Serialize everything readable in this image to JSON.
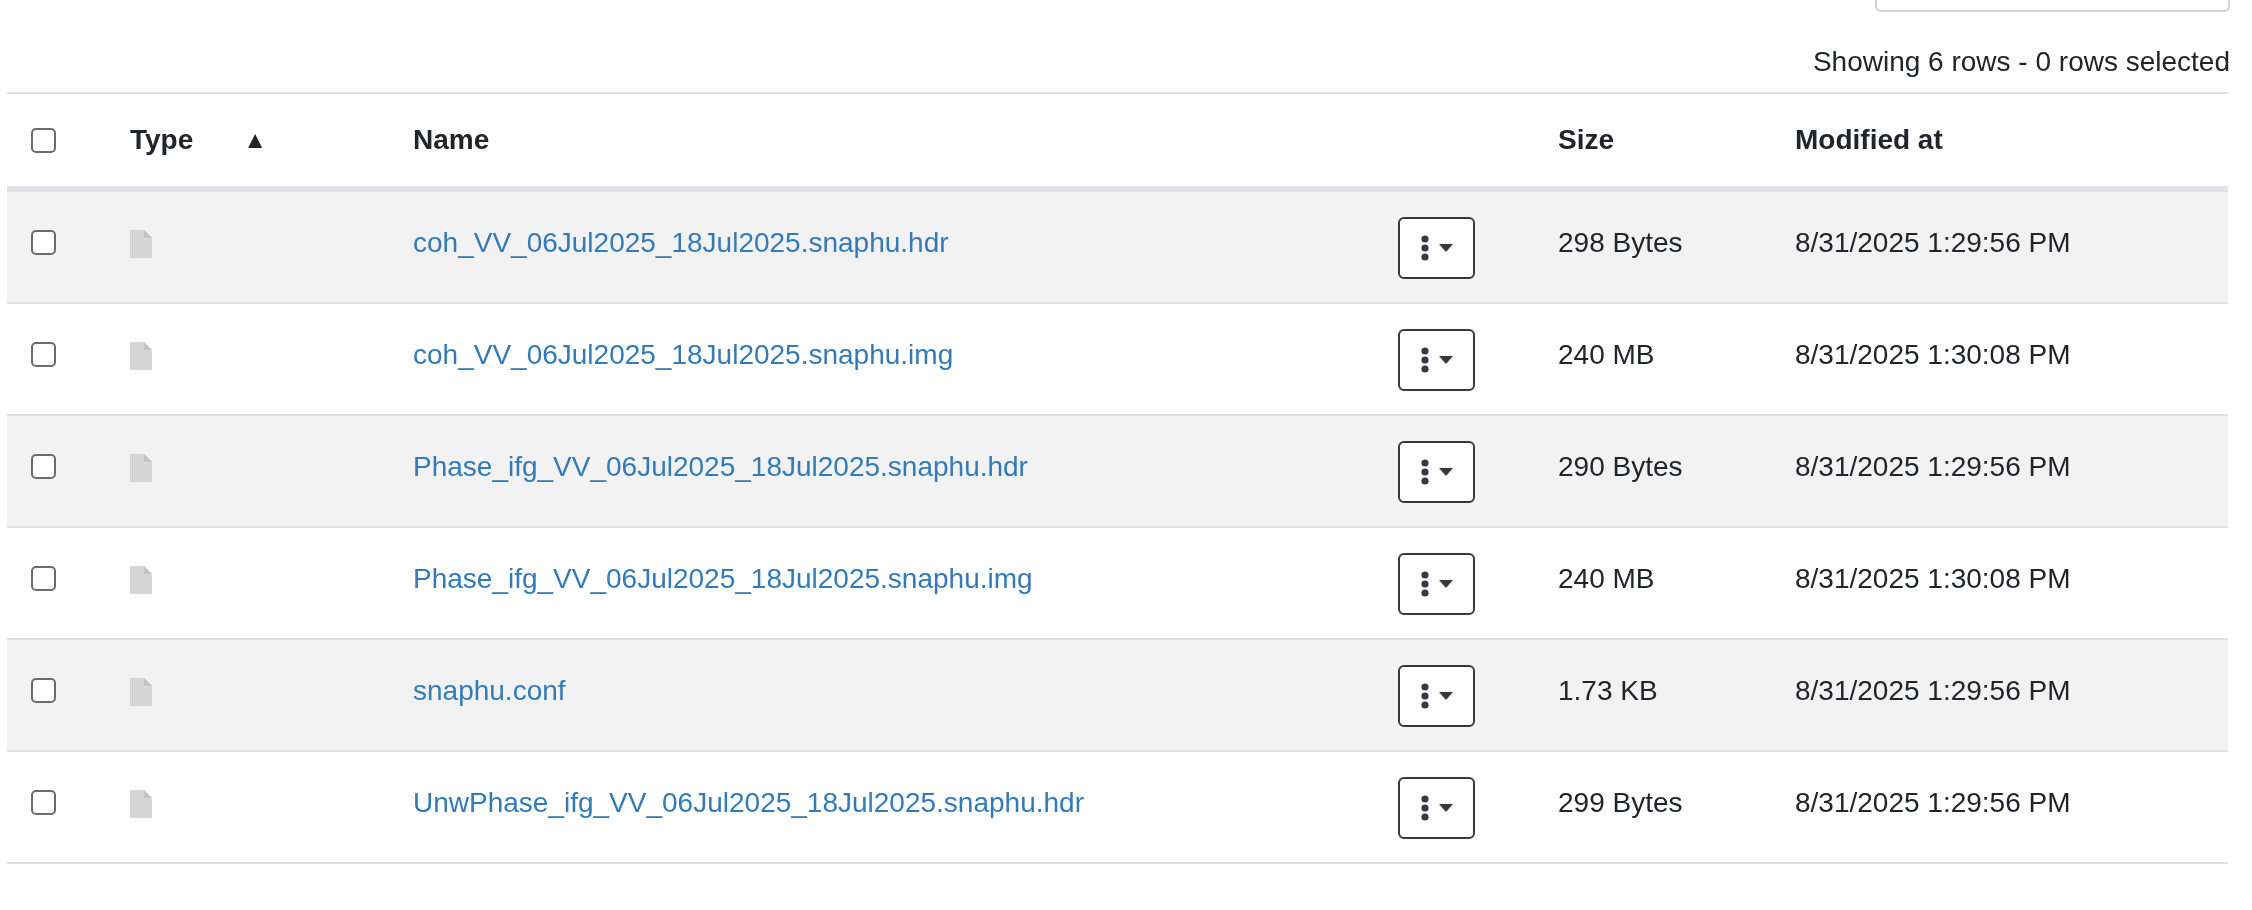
{
  "summary": "Showing 6 rows - 0 rows selected",
  "table": {
    "select_all": {
      "checked": false
    },
    "columns": [
      {
        "label": "Type",
        "sort_indicator": "▲"
      },
      {
        "label": "Name"
      },
      {
        "label": "Size"
      },
      {
        "label": "Modified at"
      }
    ],
    "rows": [
      {
        "checked": false,
        "name": "coh_VV_06Jul2025_18Jul2025.snaphu.hdr",
        "size": "298 Bytes",
        "modified": "8/31/2025 1:29:56 PM"
      },
      {
        "checked": false,
        "name": "coh_VV_06Jul2025_18Jul2025.snaphu.img",
        "size": "240 MB",
        "modified": "8/31/2025 1:30:08 PM"
      },
      {
        "checked": false,
        "name": "Phase_ifg_VV_06Jul2025_18Jul2025.snaphu.hdr",
        "size": "290 Bytes",
        "modified": "8/31/2025 1:29:56 PM"
      },
      {
        "checked": false,
        "name": "Phase_ifg_VV_06Jul2025_18Jul2025.snaphu.img",
        "size": "240 MB",
        "modified": "8/31/2025 1:30:08 PM"
      },
      {
        "checked": false,
        "name": "snaphu.conf",
        "size": "1.73 KB",
        "modified": "8/31/2025 1:29:56 PM"
      },
      {
        "checked": false,
        "name": "UnwPhase_ifg_VV_06Jul2025_18Jul2025.snaphu.hdr",
        "size": "299 Bytes",
        "modified": "8/31/2025 1:29:56 PM"
      }
    ]
  }
}
